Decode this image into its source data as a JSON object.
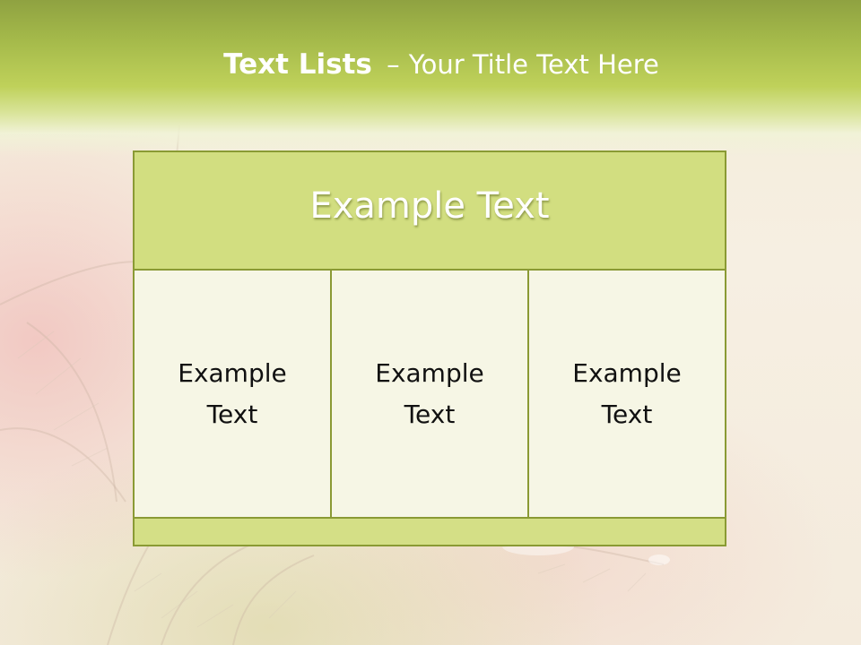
{
  "slide": {
    "title_bold": "Text Lists",
    "title_separator": "–",
    "title_rest": "Your Title Text Here"
  },
  "diagram": {
    "header": "Example Text",
    "columns": [
      {
        "line1": "Example",
        "line2": "Text"
      },
      {
        "line1": "Example",
        "line2": "Text"
      },
      {
        "line1": "Example",
        "line2": "Text"
      }
    ]
  },
  "colors": {
    "title_band": "#a4b94a",
    "header_fill": "#d2de80",
    "column_fill": "#f6f6e5",
    "border": "#8a9a34",
    "footer_fill": "#d4df86"
  }
}
